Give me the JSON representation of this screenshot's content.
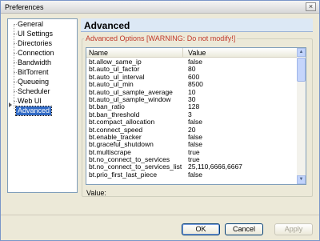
{
  "window": {
    "title": "Preferences",
    "close_glyph": "×"
  },
  "nav": {
    "items": [
      {
        "label": "General"
      },
      {
        "label": "UI Settings"
      },
      {
        "label": "Directories"
      },
      {
        "label": "Connection"
      },
      {
        "label": "Bandwidth"
      },
      {
        "label": "BitTorrent"
      },
      {
        "label": "Queueing"
      },
      {
        "label": "Scheduler"
      },
      {
        "label": "Web UI"
      },
      {
        "label": "Advanced",
        "selected": true
      }
    ]
  },
  "panel": {
    "title": "Advanced",
    "group_label": "Advanced Options [WARNING: Do not modify!]",
    "columns": {
      "name": "Name",
      "value": "Value"
    },
    "rows": [
      {
        "name": "bt.allow_same_ip",
        "value": "false"
      },
      {
        "name": "bt.auto_ul_factor",
        "value": "80"
      },
      {
        "name": "bt.auto_ul_interval",
        "value": "600"
      },
      {
        "name": "bt.auto_ul_min",
        "value": "8500"
      },
      {
        "name": "bt.auto_ul_sample_average",
        "value": "10"
      },
      {
        "name": "bt.auto_ul_sample_window",
        "value": "30"
      },
      {
        "name": "bt.ban_ratio",
        "value": "128"
      },
      {
        "name": "bt.ban_threshold",
        "value": "3"
      },
      {
        "name": "bt.compact_allocation",
        "value": "false"
      },
      {
        "name": "bt.connect_speed",
        "value": "20"
      },
      {
        "name": "bt.enable_tracker",
        "value": "false"
      },
      {
        "name": "bt.graceful_shutdown",
        "value": "false"
      },
      {
        "name": "bt.multiscrape",
        "value": "true"
      },
      {
        "name": "bt.no_connect_to_services",
        "value": "true"
      },
      {
        "name": "bt.no_connect_to_services_list",
        "value": "25,110,6666,6667"
      },
      {
        "name": "bt.prio_first_last_piece",
        "value": "false"
      }
    ],
    "value_label": "Value:"
  },
  "buttons": {
    "ok": "OK",
    "cancel": "Cancel",
    "apply": "Apply"
  },
  "colors": {
    "selection": "#316ac5",
    "warning": "#c0392b",
    "header_bg": "#dce8f5"
  }
}
